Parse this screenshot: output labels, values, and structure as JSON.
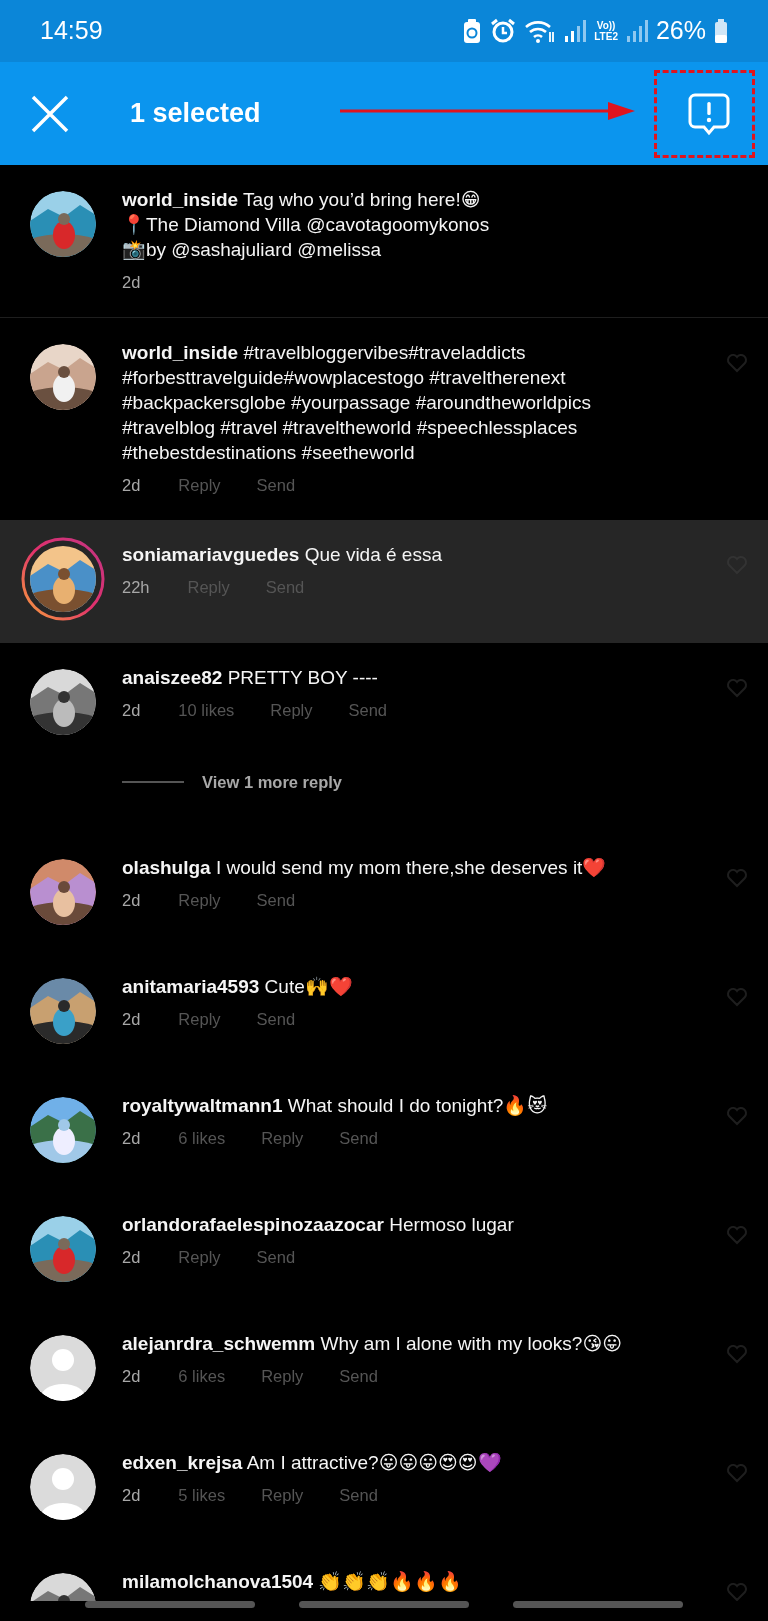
{
  "status_bar": {
    "time": "14:59",
    "network_top": "Vo))",
    "network_bottom": "LTE2",
    "battery": "26%"
  },
  "header": {
    "title": "1 selected"
  },
  "comments": [
    {
      "kind": "caption",
      "username": "world_inside",
      "text": "Tag who you’d bring here!😁\n📍The Diamond Villa @cavotagoomykonos\n📸by @sashajuliard @melissa",
      "avatar": {
        "kind": "picture"
      },
      "story_ring": false,
      "selected": false,
      "time": "2d"
    },
    {
      "kind": "comment",
      "username": "world_inside",
      "text": "#travelbloggervibes#traveladdicts\n#forbesttravelguide#wowplacestogo #traveltherenext\n#backpackersglobe #yourpassage #aroundtheworldpics\n#travelblog #travel #traveltheworld #speechlessplaces\n#thebestdestinations #seetheworld",
      "avatar": {
        "kind": "picture"
      },
      "story_ring": false,
      "selected": false,
      "time": "2d",
      "actions": [
        "Reply",
        "Send"
      ]
    },
    {
      "kind": "comment",
      "username": "soniamariavguedes",
      "text": "Que vida é essa",
      "avatar": {
        "kind": "picture"
      },
      "story_ring": true,
      "selected": true,
      "time": "22h",
      "actions": [
        "Reply",
        "Send"
      ]
    },
    {
      "kind": "comment",
      "username": "anaiszee82",
      "text": "PRETTY BOY ----",
      "avatar": {
        "kind": "picture"
      },
      "story_ring": false,
      "selected": false,
      "time": "2d",
      "actions": [
        "10 likes",
        "Reply",
        "Send"
      ],
      "more_replies": "View 1 more reply"
    },
    {
      "kind": "comment",
      "username": "olashulga",
      "text": "I would send my mom there,she deserves it❤️",
      "avatar": {
        "kind": "picture"
      },
      "story_ring": false,
      "selected": false,
      "time": "2d",
      "actions": [
        "Reply",
        "Send"
      ]
    },
    {
      "kind": "comment",
      "username": "anitamaria4593",
      "text": "Cute🙌❤️",
      "avatar": {
        "kind": "picture"
      },
      "story_ring": false,
      "selected": false,
      "time": "2d",
      "actions": [
        "Reply",
        "Send"
      ]
    },
    {
      "kind": "comment",
      "username": "royaltywaltmann1",
      "text": "What should I do tonight?🔥😻",
      "avatar": {
        "kind": "picture"
      },
      "story_ring": false,
      "selected": false,
      "time": "2d",
      "actions": [
        "6 likes",
        "Reply",
        "Send"
      ]
    },
    {
      "kind": "comment",
      "username": "orlandorafaelespinozaazocar",
      "text": "Hermoso lugar",
      "avatar": {
        "kind": "picture"
      },
      "story_ring": false,
      "selected": false,
      "time": "2d",
      "actions": [
        "Reply",
        "Send"
      ]
    },
    {
      "kind": "comment",
      "username": "alejanrdra_schwemm",
      "text": "Why am I alone with my looks?😘😛",
      "avatar": {
        "kind": "default"
      },
      "story_ring": false,
      "selected": false,
      "time": "2d",
      "actions": [
        "6 likes",
        "Reply",
        "Send"
      ]
    },
    {
      "kind": "comment",
      "username": "edxen_krejsa",
      "text": "Am I attractive?😛😛😛😍😍💜",
      "avatar": {
        "kind": "default"
      },
      "story_ring": false,
      "selected": false,
      "time": "2d",
      "actions": [
        "5 likes",
        "Reply",
        "Send"
      ]
    },
    {
      "kind": "comment",
      "username": "milamolchanova1504",
      "text": "👏👏👏🔥🔥🔥",
      "avatar": {
        "kind": "picture"
      },
      "story_ring": false,
      "selected": false
    }
  ]
}
